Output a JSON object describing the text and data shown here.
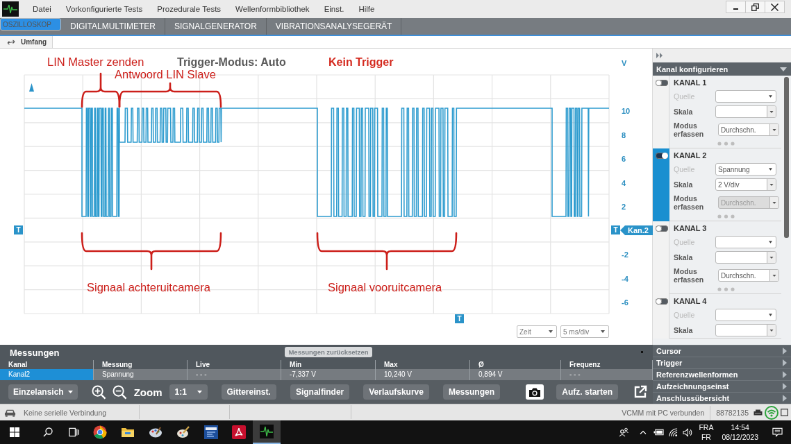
{
  "menu": [
    "Datei",
    "Vorkonfigurierte Tests",
    "Prozedurale Tests",
    "Wellenformbibliothek",
    "Einst.",
    "Hilfe"
  ],
  "tabs": [
    {
      "label": "OSZILLOSKOP",
      "selected": true
    },
    {
      "label": "DIGITALMULTIMETER",
      "selected": false
    },
    {
      "label": "SIGNALGENERATOR",
      "selected": false
    },
    {
      "label": "VIBRATIONSANALYSEGERÄT",
      "selected": false
    }
  ],
  "subbar": {
    "button": "Umfang"
  },
  "scope": {
    "trigger_mode": "Trigger-Modus: Auto",
    "trigger_status": "Kein Trigger",
    "y_unit": "V",
    "y_labels": [
      "10",
      "8",
      "6",
      "4",
      "2",
      "-2",
      "-4",
      "-6"
    ],
    "trigger_markers": [
      "T",
      "T",
      "T"
    ],
    "channel_flag": "Kan.2",
    "annotations": [
      "LIN Master zenden",
      "Antwoord LIN Slave",
      "Signaal achteruitcamera",
      "Signaal vooruitcamera"
    ],
    "time_axis": "Zeit",
    "time_scale": "5 ms/div"
  },
  "side_panel": {
    "title": "Kanal konfigurieren",
    "channels": [
      {
        "name": "KANAL 1",
        "on": false,
        "fields": [
          {
            "kind": "select",
            "label": "Quelle",
            "dimmed": true,
            "disabled": false
          },
          {
            "kind": "combo",
            "label": "Skala",
            "dimmed": false,
            "disabled": false
          },
          {
            "kind": "combo",
            "label": "Modus erfassen",
            "value": "Durchschn.",
            "dimmed": false,
            "disabled": false
          }
        ]
      },
      {
        "name": "KANAL 2",
        "on": true,
        "fields": [
          {
            "kind": "select",
            "label": "Quelle",
            "value": "Spannung",
            "dimmed": true,
            "disabled": false
          },
          {
            "kind": "combo",
            "label": "Skala",
            "value": "2 V/div",
            "dimmed": false,
            "disabled": false
          },
          {
            "kind": "combo",
            "label": "Modus erfassen",
            "value": "Durchschn.",
            "dimmed": false,
            "disabled": true
          }
        ]
      },
      {
        "name": "KANAL 3",
        "on": false,
        "fields": [
          {
            "kind": "select",
            "label": "Quelle",
            "dimmed": true,
            "disabled": false
          },
          {
            "kind": "combo",
            "label": "Skala",
            "dimmed": false,
            "disabled": false
          },
          {
            "kind": "combo",
            "label": "Modus erfassen",
            "value": "Durchschn.",
            "dimmed": false,
            "disabled": false
          }
        ]
      },
      {
        "name": "KANAL 4",
        "on": false,
        "fields": [
          {
            "kind": "select",
            "label": "Quelle",
            "dimmed": true,
            "disabled": false
          },
          {
            "kind": "combo",
            "label": "Skala",
            "dimmed": false,
            "disabled": false
          }
        ]
      }
    ],
    "groups": [
      "Cursor",
      "Trigger",
      "Referenzwellenformen",
      "Aufzeichnungseinst",
      "Anschlussübersicht"
    ]
  },
  "measurements": {
    "title": "Messungen",
    "reset_button": {
      "label": "Messungen zurücksetzen",
      "disabled": true
    },
    "columns": [
      "Kanal",
      "Messung",
      "Live",
      "Min",
      "Max",
      "Ø",
      "Frequenz"
    ],
    "rows": [
      {
        "selected": true,
        "cells": [
          "Kanal2",
          "Spannung",
          "- - -",
          "-7,337 V",
          "10,240 V",
          "0,894 V",
          "- - -"
        ]
      }
    ]
  },
  "toolbar": {
    "view": "Einzelansich",
    "zoom_label": "Zoom",
    "zoom_value": "1:1",
    "buttons": [
      "Gittereinst.",
      "Signalfinder",
      "Verlaufskurve",
      "Messungen"
    ],
    "record": "Aufz. starten"
  },
  "status_bar": {
    "connection": "Keine serielle Verbindung",
    "vcmm": "VCMM mit PC verbunden",
    "serial": "88782135"
  },
  "taskbar": {
    "apps": [
      {
        "selected": false
      },
      {
        "selected": false
      },
      {
        "selected": false
      },
      {
        "selected": false
      },
      {
        "selected": false
      },
      {
        "selected": false
      },
      {
        "selected": true
      }
    ],
    "language": "FRA",
    "layout": "FR",
    "time": "14:54",
    "date": "08/12/2023"
  }
}
